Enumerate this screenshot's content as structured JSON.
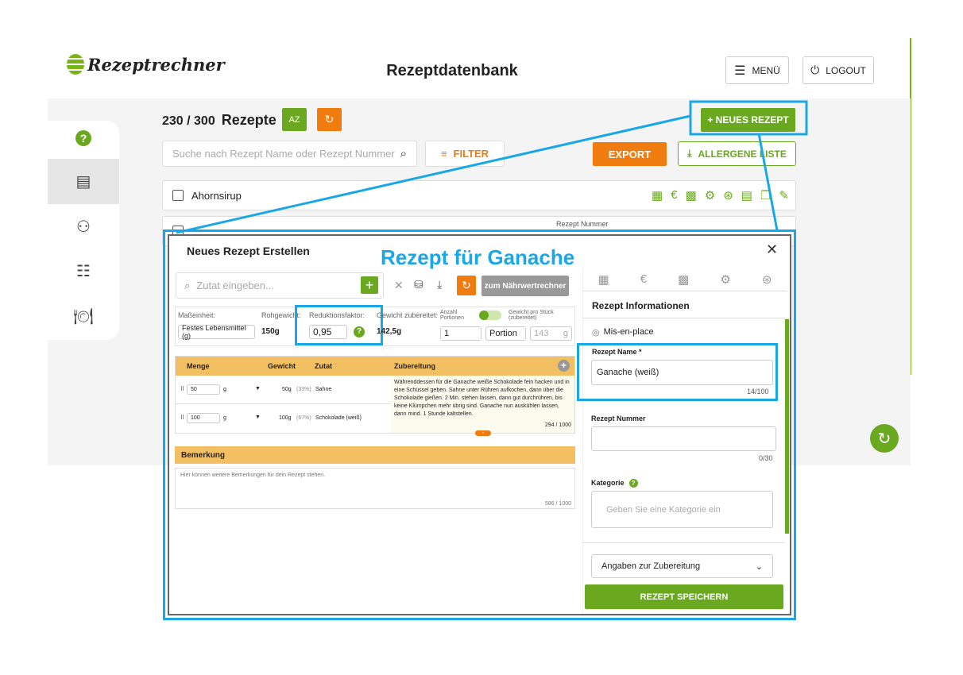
{
  "header": {
    "logo_text": "Rezeptrechner",
    "title": "Rezeptdatenbank",
    "menu_label": "MENÜ",
    "logout_label": "LOGOUT"
  },
  "sidebar": {
    "items": [
      {
        "icon": "help-icon"
      },
      {
        "icon": "recipe-book-icon",
        "active": true
      },
      {
        "icon": "user-icon"
      },
      {
        "icon": "checklist-icon"
      },
      {
        "icon": "dining-icon"
      }
    ]
  },
  "list": {
    "count": "230 / 300",
    "count_label": "Rezepte",
    "sort_label": "AZ",
    "search_placeholder": "Suche nach Rezept Name oder Rezept Nummer",
    "filter_label": "FILTER",
    "new_label": "+ NEUES REZEPT",
    "export_label": "EXPORT",
    "allergen_label": "ALLERGENE LISTE",
    "rows": [
      {
        "name": "Ahornsirup"
      },
      {
        "name": "",
        "number_label": "Rezept Nummer"
      }
    ]
  },
  "annotation": {
    "title": "Rezept für Ganache",
    "color": "#19a7e5"
  },
  "modal": {
    "title": "Neues Rezept Erstellen",
    "ingredient_placeholder": "Zutat eingeben...",
    "nutrition_button": "zum Nährwertrechner",
    "unit_label": "Maßeinheit:",
    "unit_value": "Festes Lebensmittel (g)",
    "raw_label": "Rohgewicht:",
    "raw_value": "150g",
    "reduction_label": "Reduktionsfaktor:",
    "reduction_value": "0,95",
    "prepared_label": "Gewicht zubereitet:",
    "prepared_value": "142,5g",
    "portions_label": "Anzahl Portionen",
    "portions_value": "1",
    "portion_unit": "Portion",
    "piece_label": "Gewicht pro Stück (zubereitet)",
    "piece_value": "143",
    "piece_unit": "g",
    "table": {
      "headers": [
        "Menge",
        "Gewicht",
        "Zutat",
        "Zubereitung"
      ],
      "rows": [
        {
          "amount": "50",
          "unit": "g",
          "weight": "50g",
          "pct": "(33%)",
          "ingredient": "Sahne"
        },
        {
          "amount": "100",
          "unit": "g",
          "weight": "100g",
          "pct": "(67%)",
          "ingredient": "Schokolade (weiß)"
        }
      ],
      "preparation": "Währenddessen für die Ganache weiße Schokolade fein hacken und in eine Schüssel geben. Sahne unter Rühren aufkochen, dann über die Schokolade gießen. 2 Min. stehen lassen, dann gut durchrühren, bis keine Klümpchen mehr übrig sind. Ganache nun auskühlen lassen, dann mind. 1 Stunde kaltstellen.",
      "prep_count": "294 / 1000",
      "collapse": "-"
    },
    "remarks_label": "Bemerkung",
    "remarks_placeholder": "Hier können weitere Bemerkungen für dein Rezept stehen.",
    "remarks_count": "586 / 1000",
    "panel": {
      "title": "Rezept Informationen",
      "mise": "Mis-en-place",
      "name_label": "Rezept Name *",
      "name_value": "Ganache (weiß)",
      "name_count": "14/100",
      "number_label": "Rezept Nummer",
      "number_count": "0/30",
      "category_label": "Kategorie",
      "category_placeholder": "Geben Sie eine Kategorie ein",
      "prep_dropdown": "Angaben zur Zubereitung",
      "save_label": "REZEPT SPEICHERN"
    }
  }
}
